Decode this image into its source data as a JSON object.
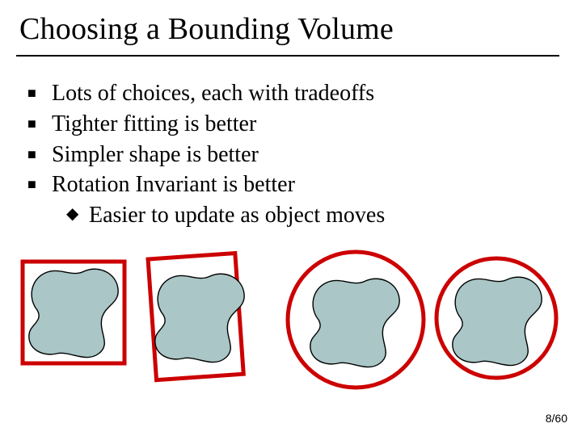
{
  "title": "Choosing a Bounding Volume",
  "bullets": {
    "items": [
      {
        "text": "Lots of choices, each with tradeoffs"
      },
      {
        "text": "Tighter fitting is better"
      },
      {
        "text": "Simpler shape is better"
      },
      {
        "text": "Rotation Invariant is better"
      }
    ],
    "subitem": {
      "text": "Easier to update as object moves"
    }
  },
  "marks": {
    "square": "■",
    "diamond": "◆"
  },
  "illustration": {
    "blob_fill": "#aac6c6",
    "blob_stroke": "#000000",
    "bv_stroke": "#cc0000",
    "kinds": [
      "aabb",
      "obb",
      "circle-loose",
      "circle-tight"
    ]
  },
  "page": {
    "current": 8,
    "total": 60,
    "label": "8/60"
  }
}
